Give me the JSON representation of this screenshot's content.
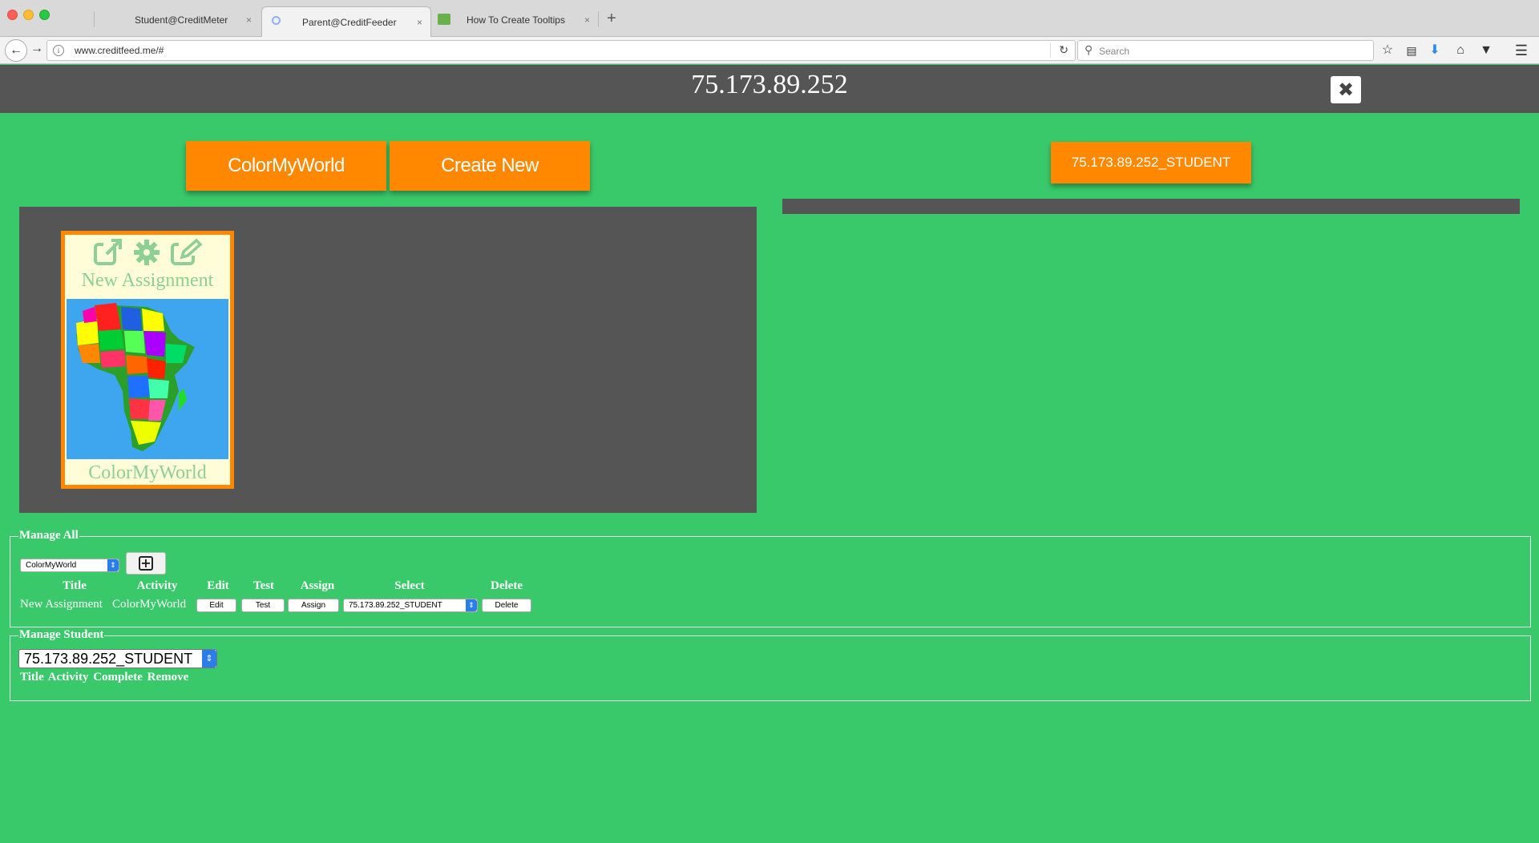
{
  "browser": {
    "tabs": [
      {
        "label": "Student@CreditMeter"
      },
      {
        "label": "Parent@CreditFeeder"
      },
      {
        "label": "How To Create Tooltips"
      }
    ],
    "tab_close": "×",
    "url": "www.creditfeed.me/#",
    "search_placeholder": "Search"
  },
  "header": {
    "title": "75.173.89.252"
  },
  "toolbar": {
    "activity_button": "ColorMyWorld",
    "create_button": "Create New",
    "student_button": "75.173.89.252_STUDENT"
  },
  "card": {
    "title": "New Assignment",
    "activity": "ColorMyWorld",
    "icons": [
      "external-link-icon",
      "gear-icon",
      "edit-icon"
    ]
  },
  "manage_all": {
    "legend": "Manage All",
    "activity_select": "ColorMyWorld",
    "headers": [
      "Title",
      "Activity",
      "Edit",
      "Test",
      "Assign",
      "Select",
      "Delete"
    ],
    "row": {
      "title": "New Assignment",
      "activity": "ColorMyWorld",
      "edit": "Edit",
      "test": "Test",
      "assign": "Assign",
      "select": "75.173.89.252_STUDENT",
      "delete": "Delete"
    }
  },
  "manage_student": {
    "legend": "Manage Student",
    "student_select": "75.173.89.252_STUDENT",
    "headers": "Title Activity Complete Remove"
  },
  "colors": {
    "page_bg": "#39c96a",
    "header_bg": "#555555",
    "accent": "#ff8800",
    "card_bg": "#fffdd8",
    "card_text": "#8dcf95"
  }
}
